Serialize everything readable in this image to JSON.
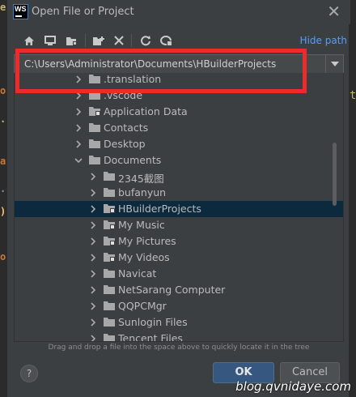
{
  "window": {
    "title": "Open File or Project",
    "app_logo_text": "WS"
  },
  "toolbar": {
    "buttons": [
      {
        "name": "home-icon"
      },
      {
        "name": "desktop-icon"
      },
      {
        "name": "project-folder-icon"
      },
      {
        "name": "new-folder-icon"
      },
      {
        "name": "delete-icon"
      },
      {
        "name": "refresh-icon"
      },
      {
        "name": "show-hidden-icon"
      }
    ],
    "hide_path_label": "Hide path"
  },
  "path": {
    "value": "C:\\Users\\Administrator\\Documents\\HBuilderProjects"
  },
  "tree": {
    "items": [
      {
        "label": ".translation",
        "expanded": false,
        "level": 1,
        "selected": false
      },
      {
        "label": ".vscode",
        "expanded": false,
        "level": 1,
        "selected": false
      },
      {
        "label": "Application Data",
        "expanded": false,
        "level": 1,
        "selected": false
      },
      {
        "label": "Contacts",
        "expanded": false,
        "level": 1,
        "selected": false
      },
      {
        "label": "Desktop",
        "expanded": false,
        "level": 1,
        "selected": false
      },
      {
        "label": "Documents",
        "expanded": true,
        "level": 1,
        "selected": false
      },
      {
        "label": "2345截图",
        "expanded": false,
        "level": 2,
        "selected": false
      },
      {
        "label": "bufanyun",
        "expanded": false,
        "level": 2,
        "selected": false
      },
      {
        "label": "HBuilderProjects",
        "expanded": false,
        "level": 2,
        "selected": true
      },
      {
        "label": "My Music",
        "expanded": false,
        "level": 2,
        "selected": false
      },
      {
        "label": "My Pictures",
        "expanded": false,
        "level": 2,
        "selected": false
      },
      {
        "label": "My Videos",
        "expanded": false,
        "level": 2,
        "selected": false
      },
      {
        "label": "Navicat",
        "expanded": false,
        "level": 2,
        "selected": false
      },
      {
        "label": "NetSarang Computer",
        "expanded": false,
        "level": 2,
        "selected": false
      },
      {
        "label": "QQPCMgr",
        "expanded": false,
        "level": 2,
        "selected": false
      },
      {
        "label": "Sunlogin Files",
        "expanded": false,
        "level": 2,
        "selected": false
      },
      {
        "label": "Tencent Files",
        "expanded": false,
        "level": 2,
        "selected": false
      }
    ]
  },
  "hint": "Drag and drop a file into the space above to quickly locate it in the tree",
  "buttons": {
    "help": "?",
    "ok": "OK",
    "cancel": "Cancel"
  },
  "watermark": "blog.qvnidaye.com",
  "colors": {
    "accent": "#589df6",
    "selection": "#0d293e",
    "highlight": "#ee2a2a",
    "folder": "#a8a8a8"
  }
}
